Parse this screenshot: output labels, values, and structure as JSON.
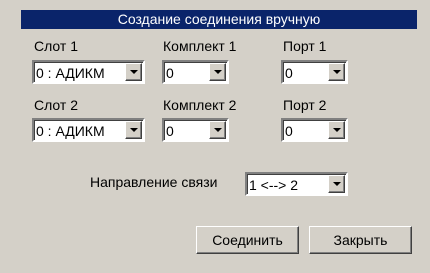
{
  "title": "Создание соединения вручную",
  "row1": {
    "slot_label": "Слот 1",
    "set_label": "Комплект 1",
    "port_label": "Порт 1",
    "slot_value": "0 : АДИКМ",
    "set_value": "0",
    "port_value": "0"
  },
  "row2": {
    "slot_label": "Слот 2",
    "set_label": "Комплект 2",
    "port_label": "Порт 2",
    "slot_value": "0 : АДИКМ",
    "set_value": "0",
    "port_value": "0"
  },
  "direction": {
    "label": "Направление связи",
    "value": "1 <--> 2"
  },
  "buttons": {
    "connect": "Соединить",
    "close": "Закрыть"
  }
}
